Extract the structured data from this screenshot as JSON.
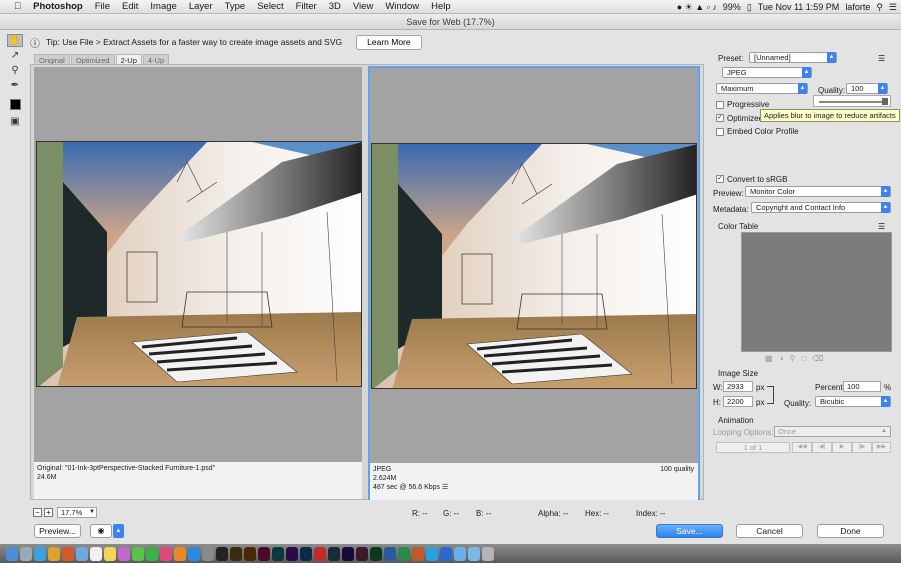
{
  "menubar": {
    "apple": "",
    "app": "Photoshop",
    "items": [
      "File",
      "Edit",
      "Image",
      "Layer",
      "Type",
      "Select",
      "Filter",
      "3D",
      "View",
      "Window",
      "Help"
    ],
    "battery": "99%",
    "clock": "Tue Nov 11  1:59 PM",
    "user": "laforte"
  },
  "dialog": {
    "title": "Save for Web (17.7%)",
    "tip": "Tip: Use File > Extract Assets for a faster way to create image assets and SVG",
    "learn_more": "Learn More",
    "tabs": [
      "Original",
      "Optimized",
      "2-Up",
      "4-Up"
    ],
    "active_tab": "2-Up"
  },
  "pane_original": {
    "line1": "Original: \"01-Ink-3ptPerspective-Stacked Furniture-1.psd\"",
    "line2": "24.6M"
  },
  "pane_optimized": {
    "format": "JPEG",
    "size": "2.624M",
    "time": "487 sec @ 56.6 Kbps",
    "quality": "100 quality"
  },
  "bottom_bar": {
    "zoom": "17.7%",
    "r": "R: --",
    "g": "G: --",
    "b": "B: --",
    "alpha": "Alpha: --",
    "hex": "Hex: --",
    "index": "Index: --"
  },
  "buttons": {
    "preview": "Preview...",
    "save": "Save...",
    "cancel": "Cancel",
    "done": "Done"
  },
  "settings": {
    "preset_label": "Preset:",
    "preset_value": "[Unnamed]",
    "format": "JPEG",
    "compression": "Maximum",
    "quality_label": "Quality:",
    "quality_value": "100",
    "progressive": "Progressive",
    "optimized": "Optimized",
    "tooltip": "Applies blur to image to reduce artifacts",
    "embed_profile": "Embed Color Profile",
    "convert_srgb": "Convert to sRGB",
    "preview_label": "Preview:",
    "preview_value": "Monitor Color",
    "metadata_label": "Metadata:",
    "metadata_value": "Copyright and Contact Info",
    "color_table": "Color Table"
  },
  "image_size": {
    "heading": "Image Size",
    "w_label": "W:",
    "w_value": "2933",
    "h_label": "H:",
    "h_value": "2200",
    "unit": "px",
    "percent_label": "Percent:",
    "percent_value": "100",
    "percent_unit": "%",
    "quality_label": "Quality:",
    "quality_value": "Bicubic"
  },
  "animation": {
    "heading": "Animation",
    "looping_label": "Looping Options:",
    "looping_value": "Once",
    "frame": "1 of 1"
  },
  "colors": {
    "accent": "#3b83f0",
    "pane_border": "#5fa3ea"
  }
}
